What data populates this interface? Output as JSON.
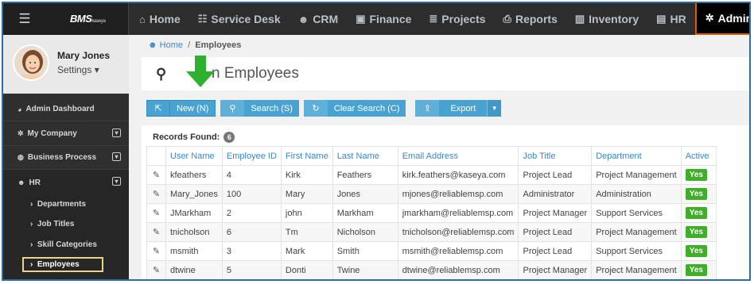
{
  "topbar": {
    "logo": "BMS",
    "logo_suffix": "kaseya",
    "nav": [
      {
        "icon": "home-icon",
        "glyph": "⌂",
        "label": "Home"
      },
      {
        "icon": "sitemap-icon",
        "glyph": "☷",
        "label": "Service Desk"
      },
      {
        "icon": "users-icon",
        "glyph": "☻",
        "label": "CRM"
      },
      {
        "icon": "money-icon",
        "glyph": "▣",
        "label": "Finance"
      },
      {
        "icon": "tasks-icon",
        "glyph": "≣",
        "label": "Projects"
      },
      {
        "icon": "print-icon",
        "glyph": "⎙",
        "label": "Reports"
      },
      {
        "icon": "barcode-icon",
        "glyph": "▥",
        "label": "Inventory"
      },
      {
        "icon": "hr-icon",
        "glyph": "▤",
        "label": "HR"
      },
      {
        "icon": "gear-icon",
        "glyph": "✲",
        "label": "Admin"
      }
    ]
  },
  "profile": {
    "name": "Mary Jones",
    "settings": "Settings ▾"
  },
  "sidebar": {
    "items": [
      {
        "label": "Admin Dashboard"
      },
      {
        "label": "My Company"
      },
      {
        "label": "Business Process"
      },
      {
        "label": "HR"
      }
    ],
    "hr_sub": [
      {
        "label": "Departments"
      },
      {
        "label": "Job Titles"
      },
      {
        "label": "Skill Categories"
      },
      {
        "label": "Employees"
      }
    ]
  },
  "breadcrumb": {
    "home": "Home",
    "separator": "/",
    "current": "Employees"
  },
  "page": {
    "title_visible": "n Employees"
  },
  "toolbar": {
    "new": "New (N)",
    "search": "Search (S)",
    "clear": "Clear Search (C)",
    "export": "Export"
  },
  "records": {
    "label": "Records Found:",
    "count": "6"
  },
  "table": {
    "columns": [
      "User Name",
      "Employee ID",
      "First Name",
      "Last Name",
      "Email Address",
      "Job Title",
      "Department",
      "Active"
    ],
    "rows": [
      [
        "kfeathers",
        "4",
        "Kirk",
        "Feathers",
        "kirk.feathers@kaseya.com",
        "Project Lead",
        "Project Management",
        "Yes"
      ],
      [
        "Mary_Jones",
        "100",
        "Mary",
        "Jones",
        "mjones@reliablemsp.com",
        "Administrator",
        "Administration",
        "Yes"
      ],
      [
        "JMarkham",
        "2",
        "john",
        "Markham",
        "jmarkham@reliablemsp.com",
        "Project Manager",
        "Support Services",
        "Yes"
      ],
      [
        "tnicholson",
        "6",
        "Tm",
        "Nicholson",
        "tnicholson@reliablemsp.com",
        "Project Lead",
        "Project Management",
        "Yes"
      ],
      [
        "msmith",
        "3",
        "Mark",
        "Smith",
        "msmith@reliablemsp.com",
        "Project Lead",
        "Support Services",
        "Yes"
      ],
      [
        "dtwine",
        "5",
        "Donti",
        "Twine",
        "dtwine@reliablemsp.com",
        "Project Manager",
        "Project Management",
        "Yes"
      ]
    ]
  },
  "colors": {
    "accent": "#49a3d1",
    "active_nav_border": "#e05a00",
    "yes_badge": "#3fae29",
    "arrow": "#2fb12f"
  }
}
